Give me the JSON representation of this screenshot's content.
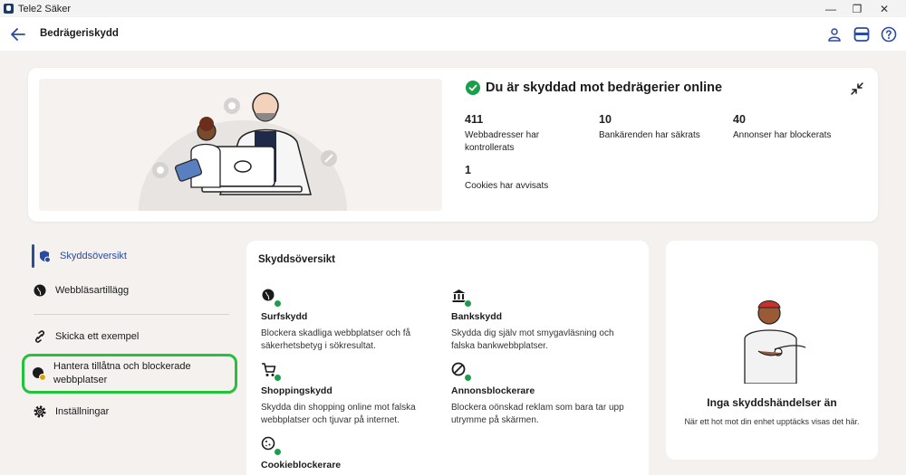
{
  "window": {
    "title": "Tele2 Säker",
    "min": "—",
    "max": "❐",
    "close": "✕"
  },
  "header": {
    "title": "Bedrägeriskydd"
  },
  "hero": {
    "status_title": "Du är skyddad mot bedrägerier online",
    "stats": [
      {
        "value": "411",
        "label": "Webbadresser har kontrollerats"
      },
      {
        "value": "10",
        "label": "Bankärenden har säkrats"
      },
      {
        "value": "40",
        "label": "Annonser har blockerats"
      },
      {
        "value": "1",
        "label": "Cookies har avvisats"
      }
    ]
  },
  "sidebar": {
    "items": [
      {
        "label": "Skyddsöversikt",
        "icon": "shield-icon",
        "active": true
      },
      {
        "label": "Webbläsartillägg",
        "icon": "globe-icon"
      },
      {
        "label": "Skicka ett exempel",
        "icon": "link-icon"
      },
      {
        "label": "Hantera tillåtna och blockerade webbplatser",
        "icon": "globe-settings-icon"
      },
      {
        "label": "Inställningar",
        "icon": "gear-icon"
      }
    ]
  },
  "overview": {
    "title": "Skyddsöversikt",
    "features": [
      {
        "name": "Surfskydd",
        "desc": "Blockera skadliga webbplatser och få säkerhetsbetyg i sökresultat.",
        "icon": "globe-icon"
      },
      {
        "name": "Bankskydd",
        "desc": "Skydda dig själv mot smygavläsning och falska bankwebbplatser.",
        "icon": "bank-icon"
      },
      {
        "name": "Shoppingskydd",
        "desc": "Skydda din shopping online mot falska webbplatser och tjuvar på internet.",
        "icon": "cart-icon"
      },
      {
        "name": "Annonsblockerare",
        "desc": "Blockera oönskad reklam som bara tar upp utrymme på skärmen.",
        "icon": "ad-block-icon"
      },
      {
        "name": "Cookieblockerare",
        "desc": "",
        "icon": "cookie-icon"
      }
    ]
  },
  "empty_state": {
    "title": "Inga skyddshändelser än",
    "desc": "När ett hot mot din enhet upptäcks visas det här."
  },
  "colors": {
    "accent": "#2a4ba0",
    "success": "#1a9e4a",
    "highlight": "#22c23a"
  }
}
